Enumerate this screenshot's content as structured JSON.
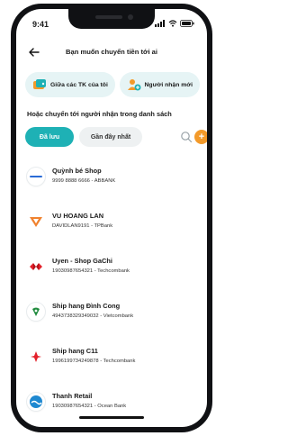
{
  "status_bar": {
    "time": "9:41"
  },
  "header": {
    "title": "Bạn muốn chuyển tiền tới ai"
  },
  "quick_actions": [
    {
      "label": "Giữa các TK của tôi",
      "icon": "wallet-icon"
    },
    {
      "label": "Người nhận mới",
      "icon": "new-recipient-icon"
    }
  ],
  "section_label": "Hoặc chuyển tới người nhận trong danh sách",
  "tabs": [
    {
      "label": "Đã lưu",
      "active": true
    },
    {
      "label": "Gần đây nhất",
      "active": false
    }
  ],
  "recipients": [
    {
      "name": "Quỳnh bé Shop",
      "detail": "9999 8888 6666 - ABBANK",
      "icon": "abbank-logo-icon",
      "color": "#2a6bd6"
    },
    {
      "name": "VU HOANG LAN",
      "detail": "DAVIDLAN9191 - TPBank",
      "icon": "tpbank-logo-icon",
      "color": "#f0822e"
    },
    {
      "name": "Uyen - Shop GaChi",
      "detail": "19030987654321 - Techcombank",
      "icon": "techcombank-logo-icon",
      "color": "#e3202a"
    },
    {
      "name": "Ship hang Đình Cong",
      "detail": "4943738329349032 - Vietcombank",
      "icon": "vietcombank-logo-icon",
      "color": "#1f8a3d"
    },
    {
      "name": "Ship hang C11",
      "detail": "1996199734249878 - Techcombank",
      "icon": "techcombank-logo-icon",
      "color": "#e3202a"
    },
    {
      "name": "Thanh Retail",
      "detail": "19030987654321 - Ocean Bank",
      "icon": "oceanbank-logo-icon",
      "color": "#1e88d0"
    }
  ],
  "colors": {
    "accent": "#1eb1b5",
    "add": "#f39a2a",
    "chip_bg": "#e6f4f5"
  }
}
